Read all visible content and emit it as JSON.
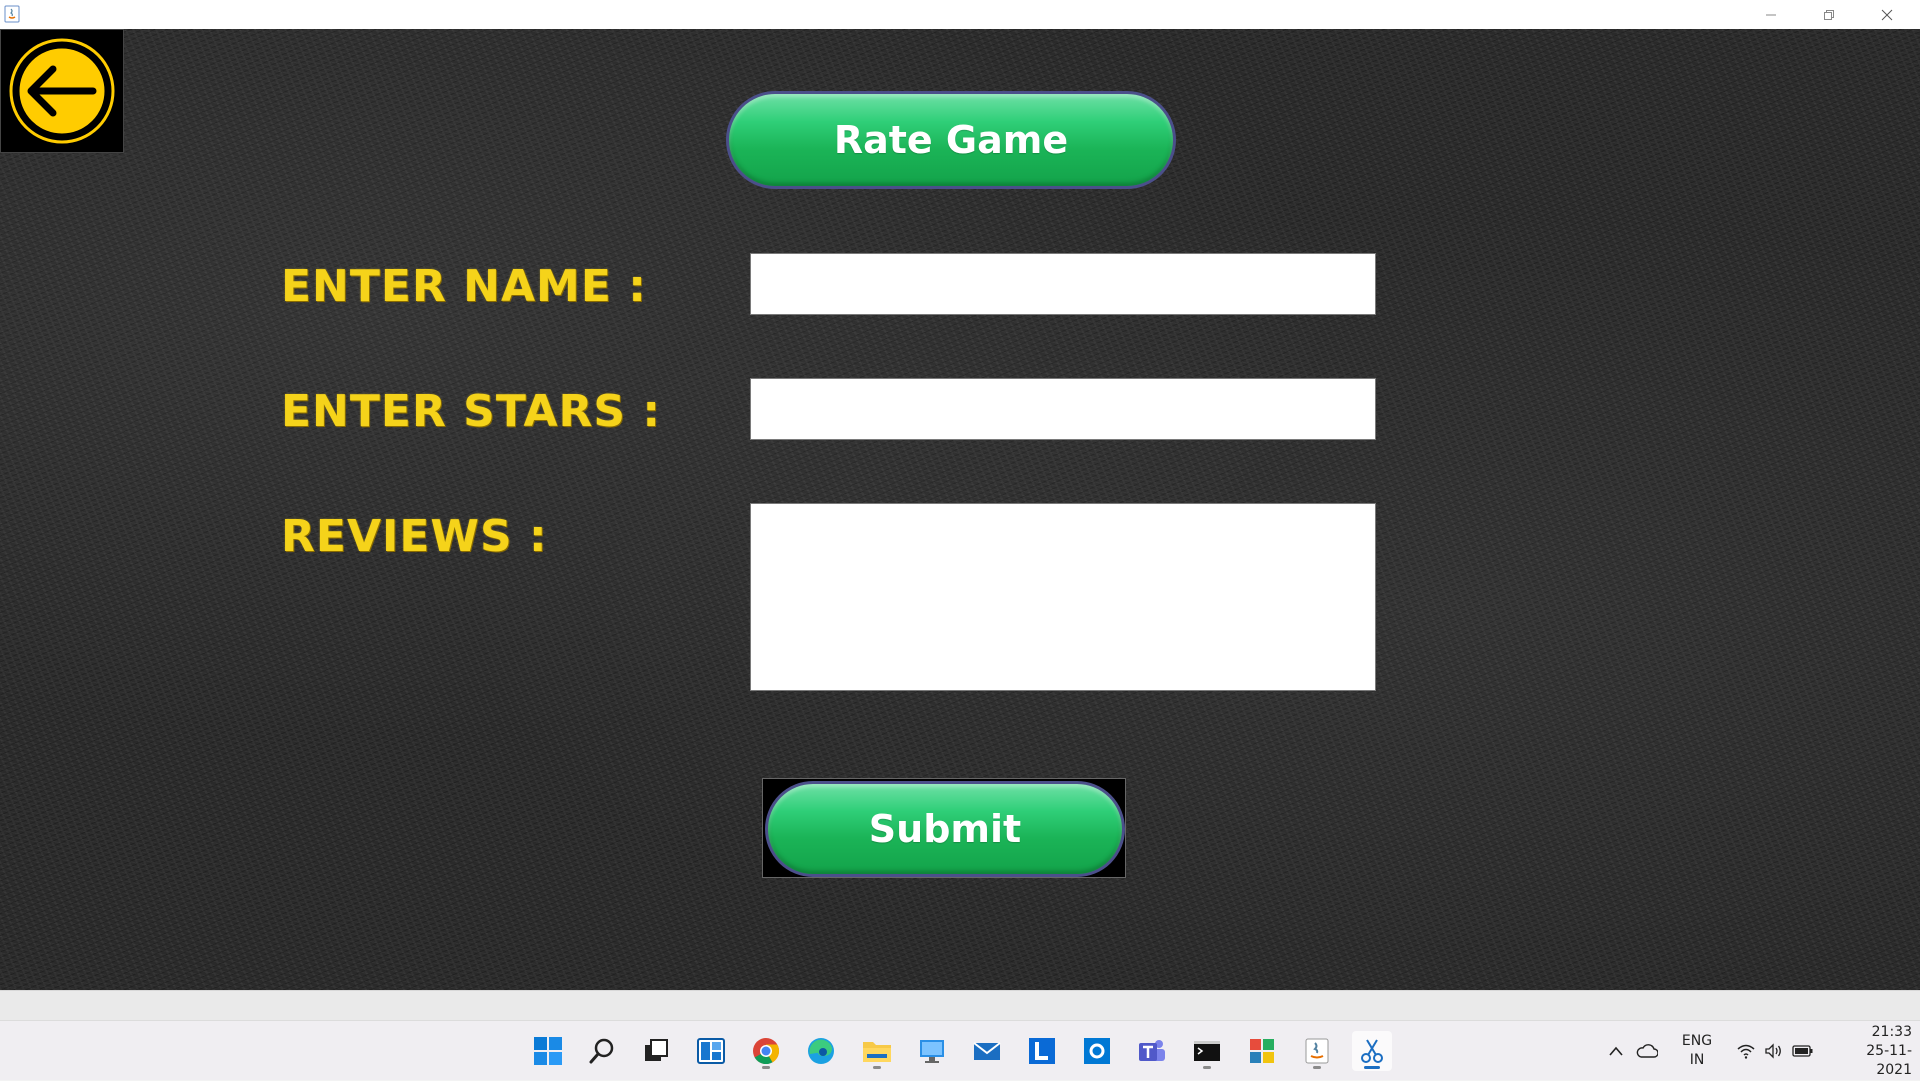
{
  "window": {
    "minimize_glyph": "—",
    "maximize_glyph": "❐",
    "close_glyph": "✕"
  },
  "form": {
    "title_button": "Rate Game",
    "name_label": "ENTER NAME :",
    "name_value": "",
    "stars_label": "ENTER STARS :",
    "stars_value": "",
    "reviews_label": "REVIEWS :",
    "reviews_value": "",
    "submit_button": "Submit"
  },
  "colors": {
    "label_yellow": "#f5d31a",
    "button_green": "#1bb457",
    "button_border": "#4b4f8a",
    "back_icon_yellow": "#ffcc00"
  },
  "taskbar": {
    "icons": [
      "windows-start-icon",
      "search-icon",
      "task-view-icon",
      "widgets-icon",
      "chrome-icon",
      "edge-icon",
      "file-explorer-icon",
      "remote-desktop-icon",
      "mail-icon",
      "l-app-icon",
      "outlook-icon",
      "teams-icon",
      "terminal-icon",
      "office-icon",
      "java-icon",
      "snipping-tool-icon"
    ],
    "tray": {
      "language": "ENG",
      "region": "IN",
      "time": "21:33",
      "date": "25-11-2021"
    }
  }
}
